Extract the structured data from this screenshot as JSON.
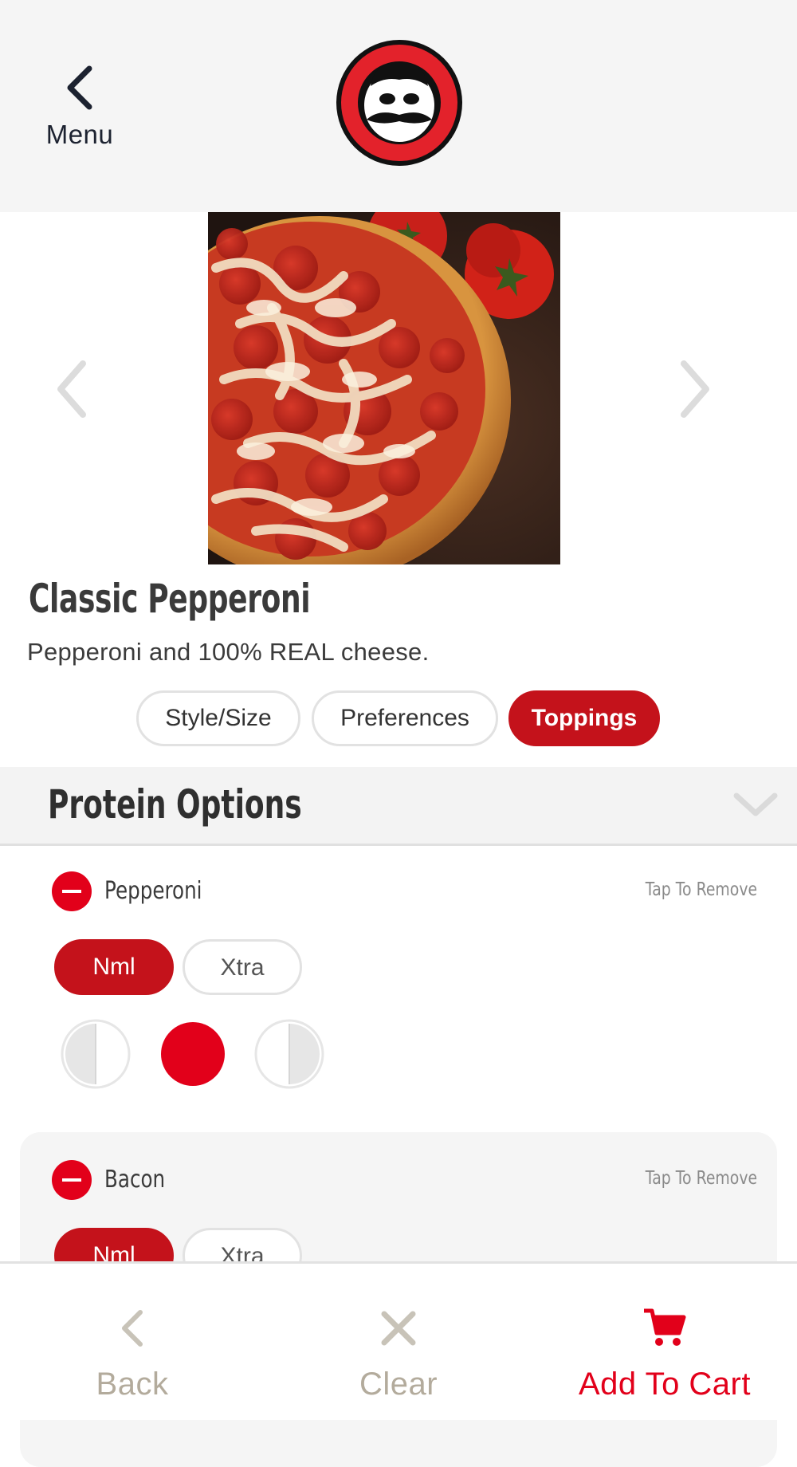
{
  "header": {
    "back_label": "Menu"
  },
  "product": {
    "name": "Classic Pepperoni",
    "description": "Pepperoni and 100% REAL cheese."
  },
  "tabs": [
    {
      "label": "Style/Size",
      "active": false
    },
    {
      "label": "Preferences",
      "active": false
    },
    {
      "label": "Toppings",
      "active": true
    }
  ],
  "section": {
    "title": "Protein Options"
  },
  "toppings": [
    {
      "name": "Pepperoni",
      "action": "Tap To Remove",
      "amounts": [
        "Nml",
        "Xtra"
      ],
      "selected_amount": "Nml",
      "portion_selected": "whole"
    },
    {
      "name": "Bacon",
      "action": "Tap To Remove",
      "amounts": [
        "Nml",
        "Xtra"
      ],
      "selected_amount": "Nml"
    }
  ],
  "bottom_bar": {
    "back_label": "Back",
    "clear_label": "Clear",
    "cart_label": "Add To Cart"
  },
  "colors": {
    "accent_red": "#c4121b",
    "bright_red": "#e2001a",
    "header_bg": "#f5f5f5",
    "muted_text": "#b3ab9c"
  },
  "icons": {
    "back": "chevron-left-icon",
    "carousel_prev": "chevron-left-icon",
    "carousel_next": "chevron-right-icon",
    "section_toggle": "chevron-down-icon",
    "remove": "minus-circle-icon",
    "clear": "x-icon",
    "cart": "cart-icon"
  }
}
